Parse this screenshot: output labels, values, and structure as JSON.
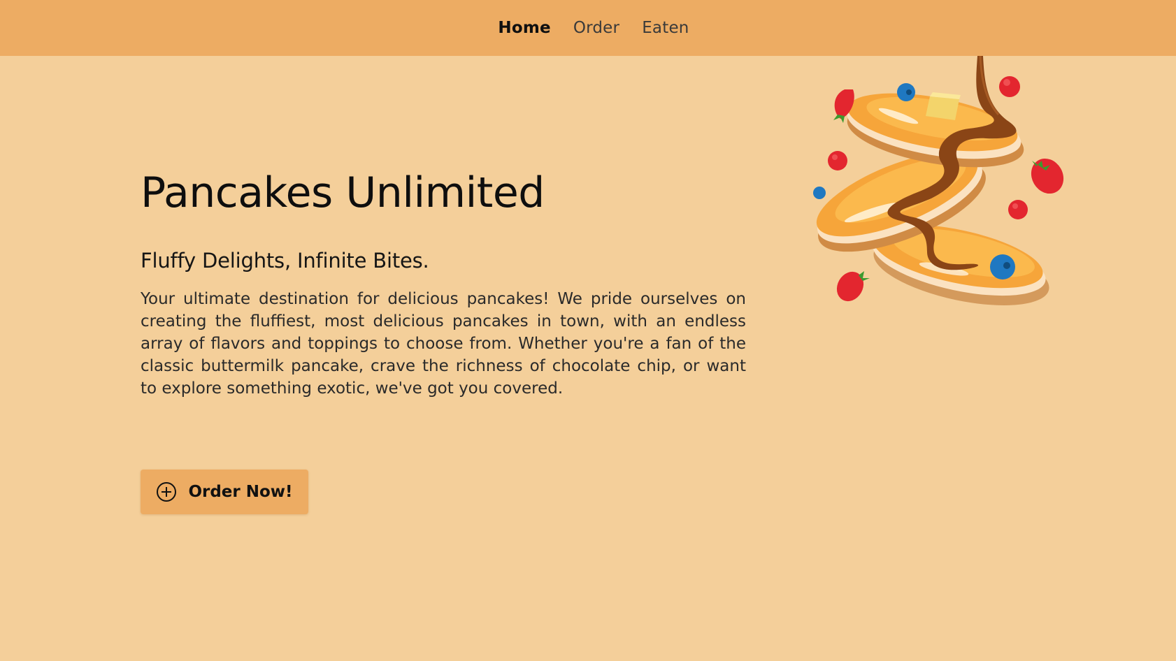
{
  "nav": {
    "items": [
      {
        "label": "Home",
        "active": true
      },
      {
        "label": "Order",
        "active": false
      },
      {
        "label": "Eaten",
        "active": false
      }
    ]
  },
  "hero": {
    "title": "Pancakes Unlimited",
    "subtitle": "Fluffy Delights, Infinite Bites.",
    "description": "Your ultimate destination for delicious pancakes! We pride ourselves on creating the fluffiest, most delicious pancakes in town, with an endless array of flavors and toppings to choose from. Whether you're a fan of the classic buttermilk pancake, crave the richness of chocolate chip, or want to explore something exotic, we've got you covered.",
    "cta_label": "Order Now!",
    "cta_icon": "plus-circle-icon"
  },
  "illustration": {
    "name": "pancake-stack-illustration"
  },
  "colors": {
    "background": "#f4cf9a",
    "navbar": "#edac63",
    "button": "#edac63",
    "pancake": "#f6a53a",
    "syrup": "#8a4516",
    "strawberry": "#e3262f",
    "blueberry": "#1f78c1",
    "butter": "#f3d46b"
  }
}
